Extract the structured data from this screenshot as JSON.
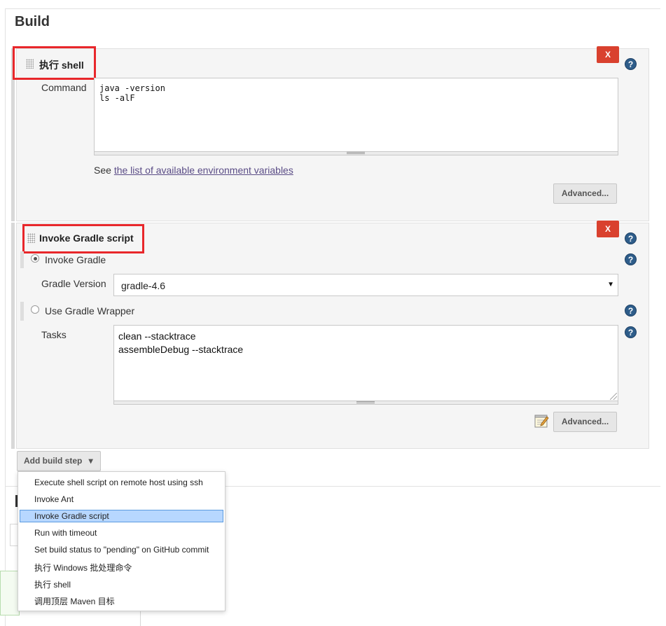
{
  "section": {
    "title": "Build"
  },
  "shell_step": {
    "title": "执行 shell",
    "delete_label": "X",
    "help_icon": "?",
    "command_label": "Command",
    "command_lines": [
      "java -version",
      "ls -alF"
    ],
    "see_prefix": "See ",
    "env_link": "the list of available environment variables",
    "advanced_label": "Advanced..."
  },
  "gradle_step": {
    "title": "Invoke Gradle script",
    "delete_label": "X",
    "help_icon": "?",
    "invoke_gradle_label": "Invoke Gradle",
    "invoke_gradle_checked": true,
    "gradle_version_label": "Gradle Version",
    "gradle_version_value": "gradle-4.6",
    "select_caret": "▼",
    "wrapper_label": "Use Gradle Wrapper",
    "wrapper_checked": false,
    "tasks_label": "Tasks",
    "tasks_lines": [
      "clean --stacktrace",
      "assembleDebug --stacktrace"
    ],
    "advanced_label": "Advanced..."
  },
  "add_step": {
    "label": "Add build step",
    "caret": "▾"
  },
  "menu": {
    "items": [
      {
        "label": "Execute shell script on remote host using ssh",
        "selected": false
      },
      {
        "label": "Invoke Ant",
        "selected": false
      },
      {
        "label": "Invoke Gradle script",
        "selected": true
      },
      {
        "label": "Run with timeout",
        "selected": false
      },
      {
        "label": "Set build status to \"pending\" on GitHub commit",
        "selected": false
      },
      {
        "label": "执行 Windows 批处理命令",
        "selected": false
      },
      {
        "label": "执行 shell",
        "selected": false
      },
      {
        "label": "调用顶层 Maven 目标",
        "selected": false
      }
    ]
  },
  "colors": {
    "highlight": "#e8272b",
    "delete_button": "#d9412e",
    "help_icon": "#2e5d8a",
    "link": "#5a4c86",
    "menu_selected": "#b7d7ff"
  },
  "icons": {
    "notepad": "notepad-icon",
    "help": "help-icon",
    "drag": "drag-handle-icon"
  }
}
